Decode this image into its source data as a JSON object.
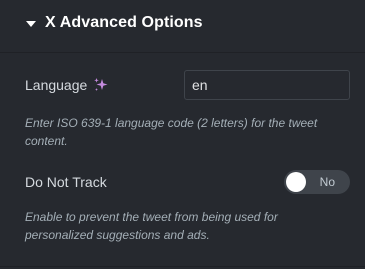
{
  "section": {
    "title": "X Advanced Options",
    "caret_icon": "caret-down-icon"
  },
  "language": {
    "label": "Language",
    "ai_icon": "sparkle-icon",
    "ai_icon_color": "#c58bde",
    "value": "en",
    "description": "Enter ISO 639-1 language code (2 letters) for the tweet content."
  },
  "do_not_track": {
    "label": "Do Not Track",
    "toggle_state": "No",
    "enabled": false,
    "description": "Enable to prevent the tweet from being used for personalized suggestions and ads."
  },
  "colors": {
    "background": "#26292f",
    "heading": "#ffffff",
    "label": "#d5dadf",
    "description": "#a4afb7",
    "switch_off": "#3f444b"
  }
}
